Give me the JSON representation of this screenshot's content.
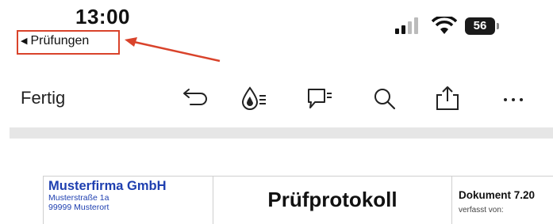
{
  "status_bar": {
    "time": "13:00",
    "battery": "56"
  },
  "nav": {
    "back_label": "Prüfungen"
  },
  "toolbar": {
    "done_label": "Fertig",
    "icons": [
      "undo-icon",
      "ink-icon",
      "comment-icon",
      "search-icon",
      "share-icon",
      "more-icon"
    ]
  },
  "annotation": {
    "color": "#d9432b"
  },
  "document": {
    "company": "Musterfirma GmbH",
    "street": "Musterstraße 1a",
    "city": "99999 Musterort",
    "title": "Prüfprotokoll",
    "doc_number": "Dokument 7.20",
    "doc_sub": "verfasst von:"
  }
}
